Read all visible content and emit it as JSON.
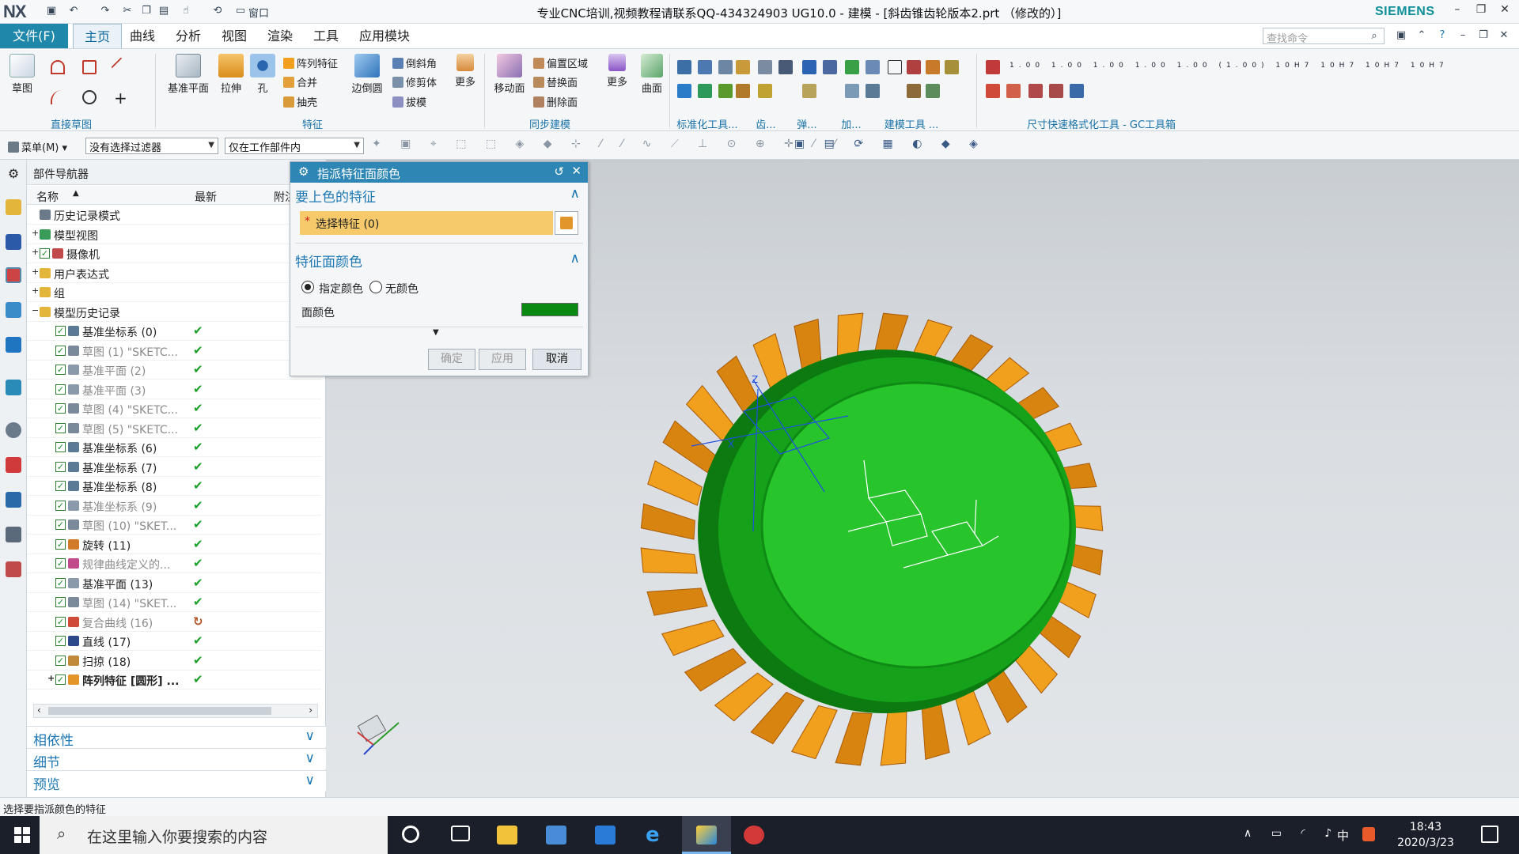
{
  "titlebar": {
    "logo": "NX",
    "window_menu": "窗口",
    "title": "专业CNC培训,视频教程请联系QQ-434324903 UG10.0 - 建模 - [斜齿锥齿轮版本2.prt （修改的）]",
    "brand": "SIEMENS"
  },
  "menubar": {
    "file": "文件(F)",
    "tabs": [
      "主页",
      "曲线",
      "分析",
      "视图",
      "渲染",
      "工具",
      "应用模块"
    ],
    "search_placeholder": "查找命令"
  },
  "ribbon": {
    "sketch": "草图",
    "group_direct_sketch": "直接草图",
    "datum_plane": "基准平面",
    "extrude": "拉伸",
    "hole": "孔",
    "pattern_feature": "阵列特征",
    "unite": "合并",
    "shell": "抽壳",
    "edge_blend": "边倒圆",
    "chamfer": "倒斜角",
    "trim_body": "修剪体",
    "draft": "拔模",
    "more1": "更多",
    "group_feature": "特征",
    "move_face": "移动面",
    "offset_region": "偏置区域",
    "replace_face": "替换面",
    "delete_face": "删除面",
    "more2": "更多",
    "surface": "曲面",
    "group_sync": "同步建模",
    "group_std": "标准化工具...",
    "group_gear": "齿...",
    "group_spring": "弹...",
    "group_add": "加...",
    "group_build": "建模工具 ...",
    "group_gc": "尺寸快速格式化工具 - GC工具箱"
  },
  "toolbar2": {
    "menu": "菜单(M)",
    "filter": "没有选择过滤器",
    "scope": "仅在工作部件内"
  },
  "navigator": {
    "title": "部件导航器",
    "col_name": "名称",
    "col_latest": "最新",
    "col_attach": "附注",
    "rows": [
      {
        "label": "历史记录模式",
        "latest": ""
      },
      {
        "label": "模型视图",
        "latest": ""
      },
      {
        "label": "摄像机",
        "latest": ""
      },
      {
        "label": "用户表达式",
        "latest": ""
      },
      {
        "label": "组",
        "latest": ""
      },
      {
        "label": "模型历史记录",
        "latest": ""
      },
      {
        "label": "基准坐标系 (0)",
        "latest": "✔"
      },
      {
        "label": "草图 (1) \"SKETC...",
        "latest": "✔"
      },
      {
        "label": "基准平面 (2)",
        "latest": "✔"
      },
      {
        "label": "基准平面 (3)",
        "latest": "✔"
      },
      {
        "label": "草图 (4) \"SKETC...",
        "latest": "✔"
      },
      {
        "label": "草图 (5) \"SKETC...",
        "latest": "✔"
      },
      {
        "label": "基准坐标系 (6)",
        "latest": "✔"
      },
      {
        "label": "基准坐标系 (7)",
        "latest": "✔"
      },
      {
        "label": "基准坐标系 (8)",
        "latest": "✔"
      },
      {
        "label": "基准坐标系 (9)",
        "latest": "✔"
      },
      {
        "label": "草图 (10) \"SKET...",
        "latest": "✔"
      },
      {
        "label": "旋转 (11)",
        "latest": "✔"
      },
      {
        "label": "规律曲线定义的...",
        "latest": "✔"
      },
      {
        "label": "基准平面 (13)",
        "latest": "✔"
      },
      {
        "label": "草图 (14) \"SKET...",
        "latest": "✔"
      },
      {
        "label": "复合曲线 (16)",
        "latest": "↻"
      },
      {
        "label": "直线 (17)",
        "latest": "✔"
      },
      {
        "label": "扫掠 (18)",
        "latest": "✔"
      },
      {
        "label": "阵列特征 [圆形] ...",
        "latest": "✔"
      }
    ],
    "dependencies": "相依性",
    "details": "细节",
    "preview": "预览"
  },
  "dialog": {
    "title": "指派特征面颜色",
    "section1": "要上色的特征",
    "select_feature": "选择特征 (0)",
    "section2": "特征面颜色",
    "opt_specify": "指定颜色",
    "opt_none": "无颜色",
    "face_color_label": "面颜色",
    "face_color": "#0a8a12",
    "ok": "确定",
    "apply": "应用",
    "cancel": "取消"
  },
  "status": "选择要指派颜色的特征",
  "taskbar": {
    "search": "在这里输入你要搜索的内容",
    "ime": "中",
    "time": "18:43",
    "date": "2020/3/23"
  },
  "colors": {
    "accent": "#2d86b3",
    "gear": "#f0a01c",
    "gear_face": "#19b21c"
  }
}
